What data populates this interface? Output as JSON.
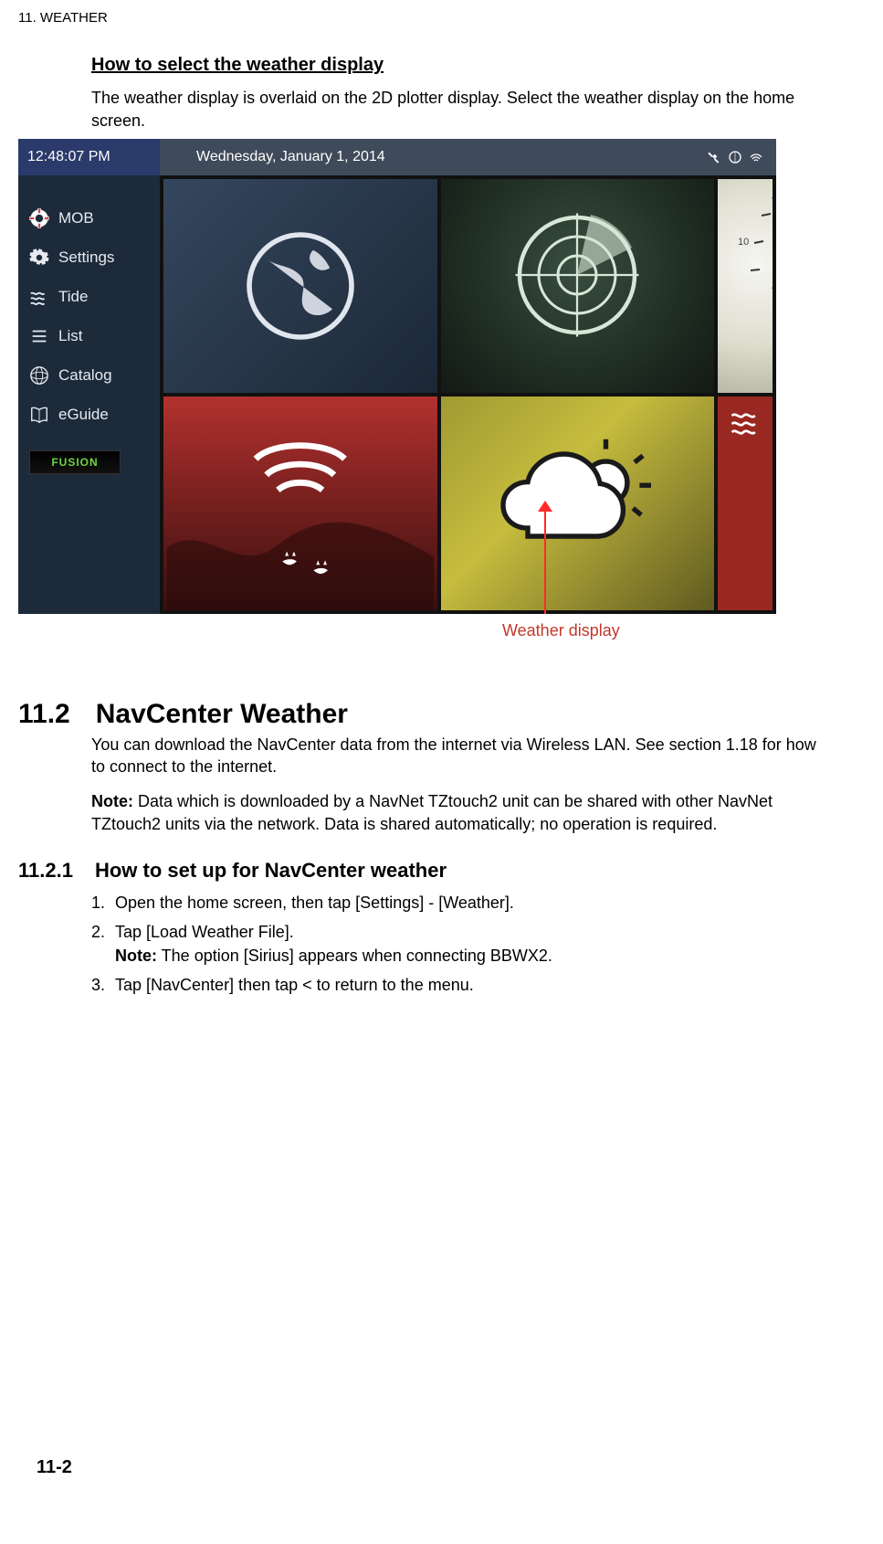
{
  "chapter_header": "11.  WEATHER",
  "howto_heading": "How to select the weather display",
  "howto_para": "The weather display is overlaid on the 2D plotter display. Select the weather display on the home screen.",
  "screenshot": {
    "time": "12:48:07 PM",
    "date": "Wednesday, January 1, 2014",
    "sidebar": {
      "items": [
        {
          "label": "MOB"
        },
        {
          "label": "Settings"
        },
        {
          "label": "Tide"
        },
        {
          "label": "List"
        },
        {
          "label": "Catalog"
        },
        {
          "label": "eGuide"
        }
      ],
      "fusion_label": "FUSION"
    }
  },
  "callout": "Weather display",
  "section": {
    "num": "11.2",
    "title": "NavCenter Weather",
    "para1": "You can download the NavCenter data from the internet via Wireless LAN. See section 1.18 for how to connect to the internet.",
    "note_label": "Note:",
    "note_text": " Data which is downloaded by a NavNet TZtouch2 unit can be shared with other NavNet TZtouch2 units via the network. Data is shared automatically; no operation is required."
  },
  "subsection": {
    "num": "11.2.1",
    "title": "How to set up for NavCenter weather",
    "steps": [
      "Open the home screen, then tap [Settings] - [Weather].",
      "Tap [Load Weather File].",
      "Tap [NavCenter] then tap < to return to the menu."
    ],
    "step2_note_label": "Note:",
    "step2_note_text": " The option [Sirius] appears when connecting BBWX2."
  },
  "page_number": "11-2"
}
